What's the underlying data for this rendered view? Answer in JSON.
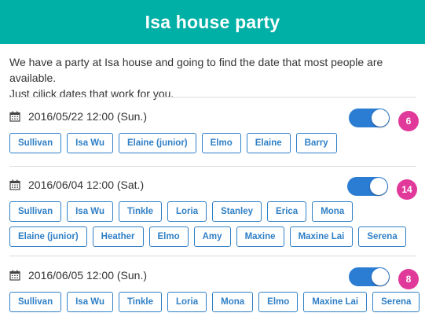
{
  "header": {
    "title": "Isa house party"
  },
  "description": {
    "line1": "We have a party at Isa house and going to find the date that most people are available.",
    "line2": "Just cilick dates that work for you."
  },
  "colors": {
    "header_bg": "#00b0a6",
    "toggle_on": "#2b7cd3",
    "badge": "#e0399a",
    "chip": "#2f7fc5"
  },
  "dates": [
    {
      "label": "2016/05/22 12:00 (Sun.)",
      "toggle_on": true,
      "count": "6",
      "people": [
        "Sullivan",
        "Isa Wu",
        "Elaine (junior)",
        "Elmo",
        "Elaine",
        "Barry"
      ]
    },
    {
      "label": "2016/06/04 12:00 (Sat.)",
      "toggle_on": true,
      "count": "14",
      "people": [
        "Sullivan",
        "Isa Wu",
        "Tinkle",
        "Loria",
        "Stanley",
        "Erica",
        "Mona",
        "Elaine (junior)",
        "Heather",
        "Elmo",
        "Amy",
        "Maxine",
        "Maxine Lai",
        "Serena"
      ]
    },
    {
      "label": "2016/06/05 12:00 (Sun.)",
      "toggle_on": true,
      "count": "8",
      "people": [
        "Sullivan",
        "Isa Wu",
        "Tinkle",
        "Loria",
        "Mona",
        "Elmo",
        "Maxine Lai",
        "Serena"
      ]
    }
  ]
}
